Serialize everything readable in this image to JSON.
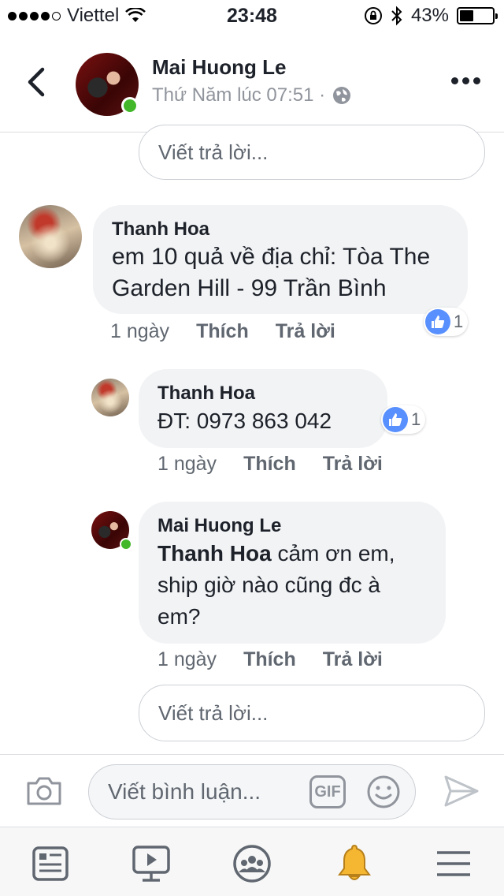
{
  "status_bar": {
    "carrier": "Viettel",
    "time": "23:48",
    "battery": "43%",
    "battery_level": 0.43
  },
  "header": {
    "name": "Mai Huong Le",
    "subtitle": "Thứ Năm lúc 07:51 ·"
  },
  "reply_placeholder_top": "Viết trả lời...",
  "comments": [
    {
      "author": "Thanh Hoa",
      "text": "em 10 quả về địa chỉ: Tòa The Garden Hill - 99 Trần  Bình",
      "likes": "1",
      "time": "1 ngày",
      "like_label": "Thích",
      "reply_label": "Trả lời"
    },
    {
      "author": "Thanh Hoa",
      "text": "ĐT: 0973 863 042",
      "likes": "1",
      "time": "1 ngày",
      "like_label": "Thích",
      "reply_label": "Trả lời"
    },
    {
      "author": "Mai Huong Le",
      "mention": "Thanh Hoa",
      "text": " cảm ơn em, ship giờ nào cũng đc à em?",
      "time": "1 ngày",
      "like_label": "Thích",
      "reply_label": "Trả lời"
    }
  ],
  "reply_placeholder_bottom": "Viết trả lời...",
  "composer": {
    "placeholder": "Viết bình luận...",
    "gif_label": "GIF"
  },
  "colors": {
    "like_blue": "#5890ff",
    "online_green": "#42b72a",
    "bell_yellow": "#f5b731"
  }
}
